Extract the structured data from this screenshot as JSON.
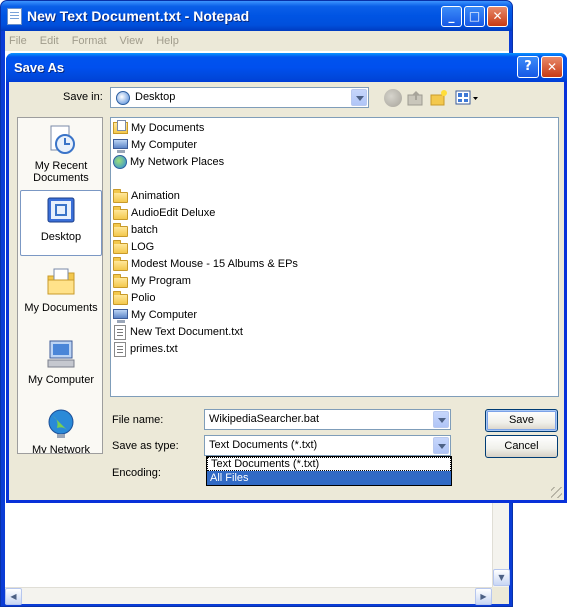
{
  "notepad": {
    "title": "New Text Document.txt - Notepad",
    "menu": [
      "File",
      "Edit",
      "Format",
      "View",
      "Help"
    ],
    "minimize": "_",
    "maximize": "□",
    "close": "✕"
  },
  "dialog": {
    "title": "Save As",
    "help": "?",
    "close": "✕",
    "save_in_label": "Save in:",
    "save_in_value": "Desktop",
    "places": [
      {
        "label": "My Recent Documents",
        "icon": "recent-documents-icon"
      },
      {
        "label": "Desktop",
        "icon": "desktop-icon"
      },
      {
        "label": "My Documents",
        "icon": "my-documents-icon"
      },
      {
        "label": "My Computer",
        "icon": "my-computer-icon"
      },
      {
        "label": "My Network",
        "icon": "my-network-icon"
      }
    ],
    "files": [
      {
        "name": "My Documents",
        "icon": "my-documents-icon"
      },
      {
        "name": "My Computer",
        "icon": "computer-icon"
      },
      {
        "name": "My Network Places",
        "icon": "network-icon"
      },
      {
        "name": "Animation",
        "icon": "folder-icon"
      },
      {
        "name": "AudioEdit Deluxe",
        "icon": "folder-icon"
      },
      {
        "name": "batch",
        "icon": "folder-icon"
      },
      {
        "name": "LOG",
        "icon": "folder-icon"
      },
      {
        "name": "Modest Mouse - 15 Albums & EPs",
        "icon": "folder-icon"
      },
      {
        "name": "My Program",
        "icon": "folder-icon"
      },
      {
        "name": "Polio",
        "icon": "folder-icon"
      },
      {
        "name": "My Computer",
        "icon": "shortcut-computer-icon"
      },
      {
        "name": "New Text Document.txt",
        "icon": "text-file-icon"
      },
      {
        "name": "primes.txt",
        "icon": "text-file-icon"
      }
    ],
    "file_name_label": "File name:",
    "file_name_value": "WikipediaSearcher.bat",
    "save_as_type_label": "Save as type:",
    "save_as_type_value": "Text Documents (*.txt)",
    "save_as_type_options": [
      "Text Documents (*.txt)",
      "All Files"
    ],
    "highlighted_option": "All Files",
    "encoding_label": "Encoding:",
    "save_button": "Save",
    "cancel_button": "Cancel"
  },
  "colors": {
    "titlebar": "#0054e3",
    "dialog_face": "#ece9d8",
    "selection": "#316ac5"
  }
}
